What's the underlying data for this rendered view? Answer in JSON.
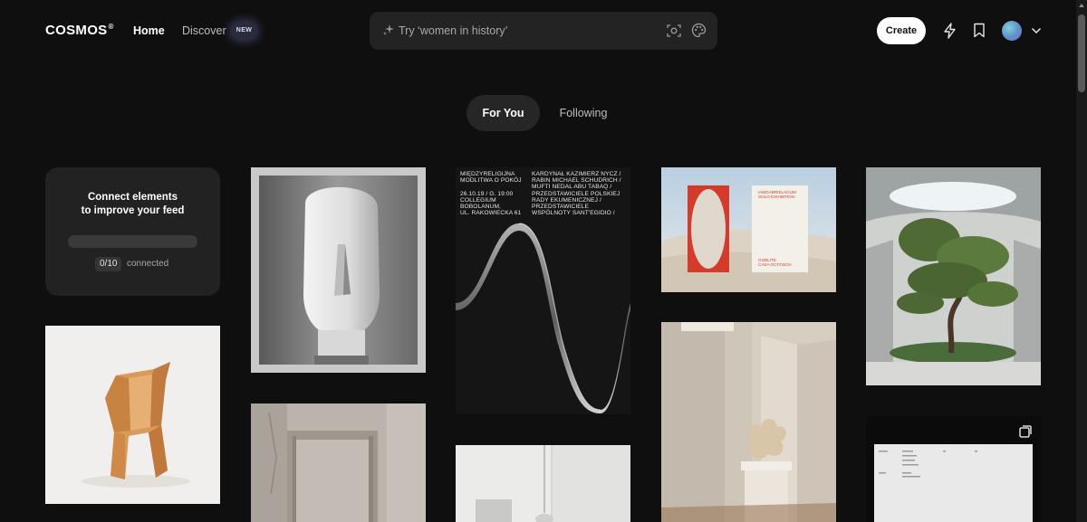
{
  "header": {
    "logo": "COSMOS",
    "logo_mark": "®",
    "nav_home": "Home",
    "nav_discover": "Discover",
    "badge_new": "NEW",
    "search_placeholder": "Try ‘women in history’",
    "create_label": "Create",
    "icons": [
      "sparkle-icon",
      "scan-icon",
      "palette-icon",
      "bolt-icon",
      "bookmark-icon",
      "chevron-down-icon"
    ]
  },
  "tabs": {
    "for_you": "For You",
    "following": "Following"
  },
  "connect_card": {
    "title": "Connect elements\nto improve your feed",
    "count": "0/10",
    "count_label": "connected",
    "progress": 0
  },
  "poster": {
    "left_text": "MIĘDZYRELIGIJNA\nMODLITWA O POKÓJ\n\n26.10.19 / G. 19:00\nCOLLEGIUM\nBOBOLANUM,\nUL. RAKOWIECKA 61",
    "right_text": "KARDYNAŁ KAZIMIERZ NYCZ /\nRABIN MICHAEL SCHUDRICH /\nMUFTI NEDAL ABU TABAQ /\nPRZEDSTAWICIELE POLSKIEJ\nRADY EKUMENICZNEJ /\nPRZEDSTAWICIELE\nWSPÓLNOTY SANT'EGIDIO /"
  },
  "exhibition": {
    "title": "IAMGABRIELAGUM\nSOLO EXHIBITION",
    "footer": "GOBLITE\nCASA OCTOGOA"
  },
  "colors": {
    "background": "#0f0f0f",
    "accent_red": "#d43b2a"
  }
}
